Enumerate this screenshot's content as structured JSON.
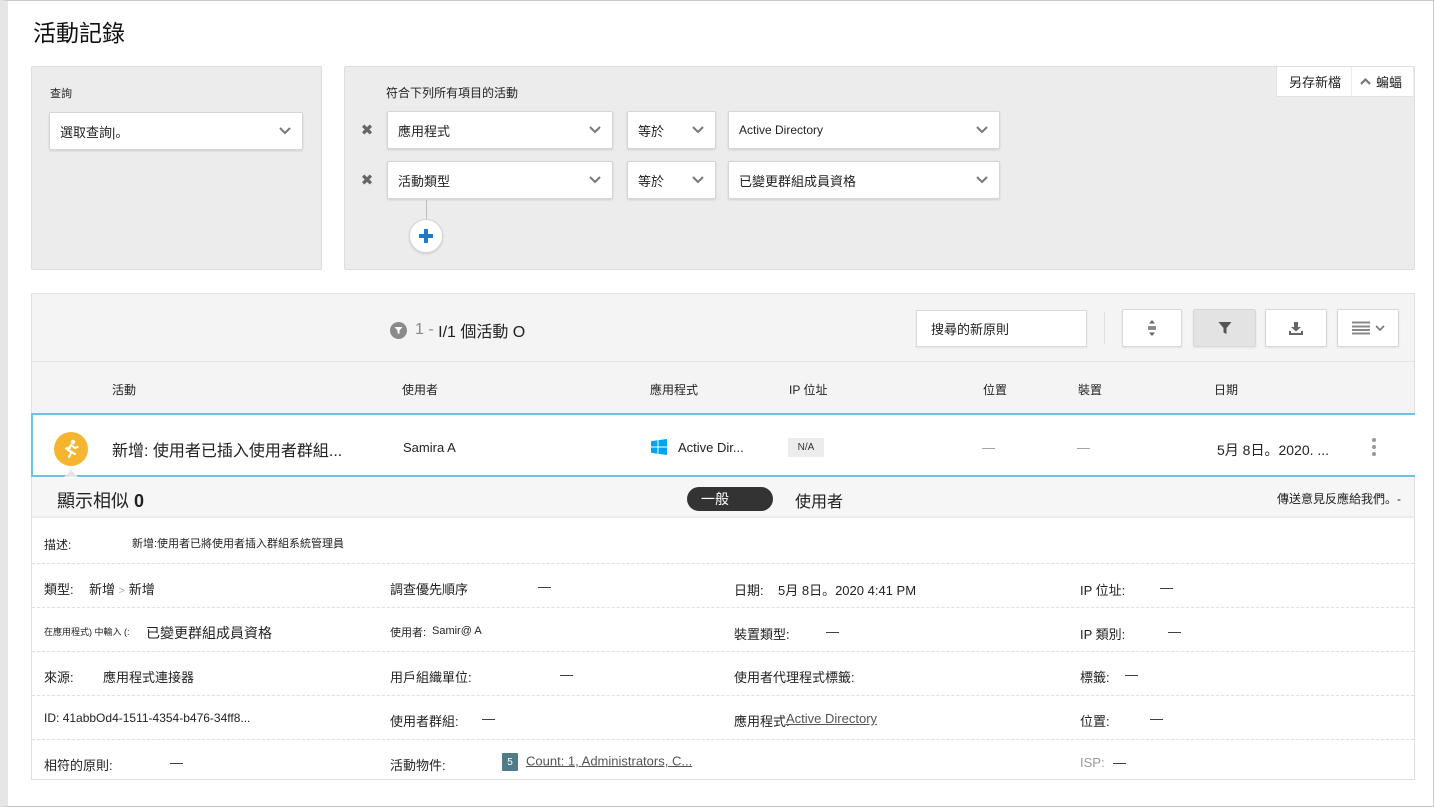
{
  "page": {
    "title": "活動記錄"
  },
  "query": {
    "label": "查詢",
    "select_value": "選取查詢|。"
  },
  "filters": {
    "heading": "符合下列所有項目的活動",
    "rows": [
      {
        "field": "應用程式",
        "operator": "等於",
        "value": "Active Directory"
      },
      {
        "field": "活動類型",
        "operator": "等於",
        "value": "已變更群組成員資格"
      }
    ],
    "save_as_label": "另存新檔",
    "collapse_label": "蝙蝠"
  },
  "results": {
    "count_prefix": "1 -",
    "count_text": "I/1 個活動 O",
    "search_placeholder": "搜尋的新原則",
    "toolbar_icons": [
      "expand-collapse-icon",
      "filter-icon",
      "download-icon",
      "columns-icon"
    ]
  },
  "table": {
    "columns": [
      "活動",
      "使用者",
      "應用程式",
      "IP 位址",
      "位置",
      "裝置",
      "日期"
    ],
    "rows": [
      {
        "activity": "新增: 使用者已插入使用者群組...",
        "user": "Samira A",
        "app": "Active Dir...",
        "ip": "N/A",
        "location": "—",
        "device": "—",
        "date": "5月 8日。2020. ..."
      }
    ]
  },
  "detail": {
    "show_similar": "顯示相似",
    "show_similar_count": "0",
    "tabs": [
      {
        "label": "一般",
        "active": true
      },
      {
        "label": "使用者",
        "active": false
      }
    ],
    "feedback": "傳送意見反應給我們。-",
    "description_label": "描述:",
    "description_value": "新增:使用者已將使用者插入群組系統管理員",
    "fields": {
      "type_label": "類型:",
      "type_value_1": "新增",
      "type_sep": ">",
      "type_value_2": "新增",
      "priority_label": "調查優先順序",
      "priority_value": "—",
      "date_label": "日期:",
      "date_value": "5月 8日。2020 4:41 PM",
      "ip_label": "IP 位址:",
      "ip_value": "—",
      "in_app_label": "在應用程式) 中輸入 (:",
      "in_app_value": "已變更群組成員資格",
      "user_label": "使用者:",
      "user_value": "Samir@ A",
      "device_type_label": "裝置類型:",
      "device_type_value": "—",
      "ip_category_label": "IP 類別:",
      "ip_category_value": "—",
      "source_label": "來源:",
      "source_value": "應用程式連接器",
      "org_unit_label": "用戶組織單位:",
      "org_unit_value": "—",
      "user_agent_label": "使用者代理程式標籤:",
      "tags_label": "標籤:",
      "tags_value": "—",
      "id_label": "ID:",
      "id_value": "41abbOd4-1511-4354-b476-34ff8...",
      "user_groups_label": "使用者群組:",
      "user_groups_value": "—",
      "app_label": "應用程式:",
      "app_value": "Active Directory",
      "location_label": "位置:",
      "location_value": "—",
      "matched_policy_label": "相符的原則:",
      "matched_policy_value": "—",
      "activity_objects_label": "活動物件:",
      "activity_objects_badge": "5",
      "activity_objects_value": "Count: 1, Administrators, C...",
      "isp_label": "ISP:",
      "isp_value": "—"
    }
  },
  "colors": {
    "accent_blue": "#1e78c8",
    "row_highlight": "#6ec1e4",
    "activity_icon": "#f5b52e",
    "windows_blue": "#00a4ef",
    "badge_teal": "#4f7c86"
  }
}
